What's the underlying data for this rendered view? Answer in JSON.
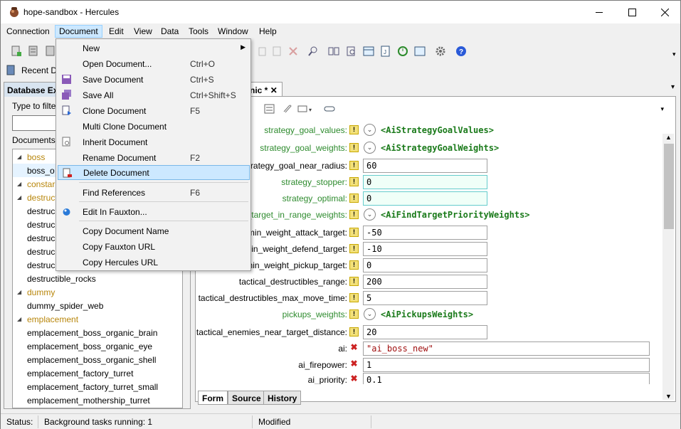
{
  "window": {
    "title": "hope-sandbox - Hercules"
  },
  "menubar": [
    "Connection",
    "Document",
    "Edit",
    "View",
    "Data",
    "Tools",
    "Window",
    "Help"
  ],
  "recent_label": "Recent D",
  "left_panel": {
    "title": "Database Ex",
    "filter_label": "Type to filte",
    "documents_label": "Documents:",
    "tree": [
      {
        "label": "boss",
        "type": "cat"
      },
      {
        "label": "boss_o",
        "type": "sel"
      },
      {
        "label": "constar",
        "type": "cat"
      },
      {
        "label": "destruct",
        "type": "cat"
      },
      {
        "label": "destruc",
        "type": "doc"
      },
      {
        "label": "destruc",
        "type": "doc"
      },
      {
        "label": "destruc",
        "type": "doc"
      },
      {
        "label": "destruc",
        "type": "doc"
      },
      {
        "label": "destruc",
        "type": "doc"
      },
      {
        "label": "destructible_rocks",
        "type": "doc"
      },
      {
        "label": "dummy",
        "type": "cat"
      },
      {
        "label": "dummy_spider_web",
        "type": "doc"
      },
      {
        "label": "emplacement",
        "type": "cat"
      },
      {
        "label": "emplacement_boss_organic_brain",
        "type": "doc"
      },
      {
        "label": "emplacement_boss_organic_eye",
        "type": "doc"
      },
      {
        "label": "emplacement_boss_organic_shell",
        "type": "doc"
      },
      {
        "label": "emplacement_factory_turret",
        "type": "doc"
      },
      {
        "label": "emplacement_factory_turret_small",
        "type": "doc"
      },
      {
        "label": "emplacement_mothership_turret",
        "type": "doc"
      }
    ]
  },
  "doc_tab": {
    "label": "nic *",
    "close": "✕"
  },
  "form_rows": [
    {
      "label": "strategy_goal_values:",
      "green": true,
      "ind": "!",
      "type": "<AiStrategyGoalValues>"
    },
    {
      "label": "strategy_goal_weights:",
      "green": true,
      "ind": "!",
      "type": "<AiStrategyGoalWeights>"
    },
    {
      "label": "strategy_goal_near_radius:",
      "green": false,
      "ind": "!",
      "value": "60"
    },
    {
      "label": "strategy_stopper:",
      "green": true,
      "ind": "!",
      "value": "0",
      "hl": true
    },
    {
      "label": "strategy_optimal:",
      "green": true,
      "ind": "!",
      "value": "0",
      "hl": true
    },
    {
      "label": "_target_in_range_weights:",
      "green": true,
      "ind": "!",
      "type": "<AiFindTargetPriorityWeights>"
    },
    {
      "label": "min_weight_attack_target:",
      "green": false,
      "ind": "!",
      "value": "-50"
    },
    {
      "label": "min_weight_defend_target:",
      "green": false,
      "ind": "!",
      "value": "-10"
    },
    {
      "label": "_min_weight_pickup_target:",
      "green": false,
      "ind": "!",
      "value": "0"
    },
    {
      "label": "tactical_destructibles_range:",
      "green": false,
      "ind": "!",
      "value": "200"
    },
    {
      "label": "tactical_destructibles_max_move_time:",
      "green": false,
      "ind": "!",
      "value": "5"
    },
    {
      "label": "pickups_weights:",
      "green": true,
      "ind": "!",
      "type": "<AiPickupsWeights>"
    },
    {
      "label": "tactical_enemies_near_target_distance:",
      "green": false,
      "ind": "!",
      "value": "20"
    },
    {
      "label": "ai:",
      "green": false,
      "ind": "✖",
      "value": "\"ai_boss_new\"",
      "wide": true,
      "str": true
    },
    {
      "label": "ai_firepower:",
      "green": false,
      "ind": "✖",
      "value": "1",
      "wide": true
    },
    {
      "label": "ai_priority:",
      "green": false,
      "ind": "✖",
      "value": "0.1",
      "wide": true
    }
  ],
  "bottom_tabs": [
    "Form",
    "Source",
    "History"
  ],
  "status": {
    "label": "Status:",
    "tasks": "Background tasks running: 1",
    "modified": "Modified"
  },
  "document_menu": [
    {
      "label": "New",
      "shortcut": "",
      "arrow": "▶"
    },
    {
      "label": "Open Document...",
      "shortcut": "Ctrl+O"
    },
    {
      "label": "Save Document",
      "shortcut": "Ctrl+S"
    },
    {
      "label": "Save All",
      "shortcut": "Ctrl+Shift+S"
    },
    {
      "label": "Clone Document",
      "shortcut": "F5"
    },
    {
      "label": "Multi Clone Document",
      "shortcut": ""
    },
    {
      "label": "Inherit Document",
      "shortcut": ""
    },
    {
      "label": "Rename Document",
      "shortcut": "F2"
    },
    {
      "label": "Delete Document",
      "shortcut": ""
    },
    {
      "label": "Find References",
      "shortcut": "F6"
    },
    {
      "label": "Edit In Fauxton...",
      "shortcut": ""
    },
    {
      "label": "Copy Document Name",
      "shortcut": ""
    },
    {
      "label": "Copy Fauxton URL",
      "shortcut": ""
    },
    {
      "label": "Copy Hercules URL",
      "shortcut": ""
    }
  ]
}
